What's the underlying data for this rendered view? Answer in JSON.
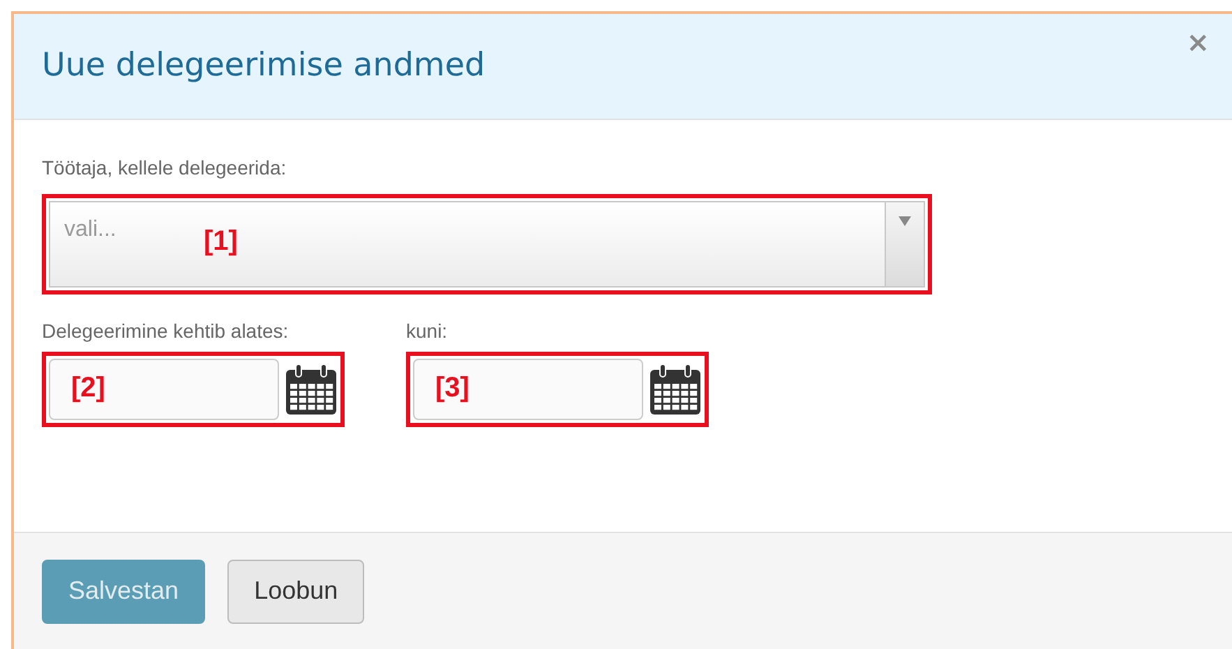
{
  "dialog": {
    "title": "Uue delegeerimise andmed",
    "close": "×"
  },
  "employee_field": {
    "label": "Töötaja, kellele delegeerida:",
    "placeholder": "vali...",
    "callout": "[1]"
  },
  "date_fields": [
    {
      "label": "Delegeerimine kehtib alates:",
      "callout": "[2]"
    },
    {
      "label": "kuni:",
      "callout": "[3]"
    }
  ],
  "buttons": [
    {
      "label": "Salvestan",
      "kind": "primary",
      "disabled": true
    },
    {
      "label": "Loobun",
      "kind": "secondary",
      "disabled": false
    }
  ]
}
